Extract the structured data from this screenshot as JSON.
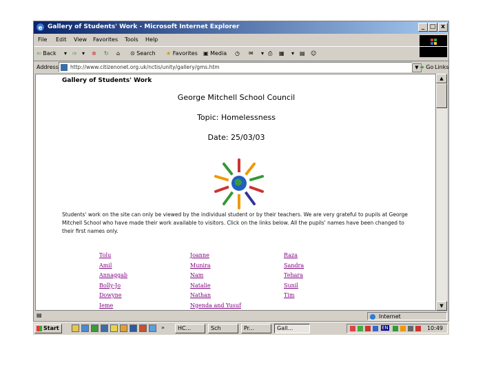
{
  "window": {
    "title": "Gallery of Students' Work - Microsoft Internet Explorer",
    "controls": [
      "_",
      "□",
      "x"
    ]
  },
  "menu": [
    "File",
    "Edit",
    "View",
    "Favorites",
    "Tools",
    "Help"
  ],
  "toolbar": {
    "back": "Back",
    "search": "Search",
    "favorites": "Favorites",
    "media": "Media"
  },
  "address": {
    "label": "Address",
    "url": "http://www.citizenonet.org.uk/nctis/unity/gallery/gms.htm",
    "go": "Go",
    "links": "Links"
  },
  "page": {
    "header": "Gallery of Students' Work",
    "school": "George Mitchell School Council",
    "topic": "Topic: Homelessness",
    "date": "Date: 25/03/03",
    "paragraph": "Students' work on the site can only be viewed by the individual student or by their teachers. We are very grateful to pupils at George Mitchell School who have made their work available to visitors. Click on the links below. All the pupils' names have been changed to their first names only.",
    "names_col1": [
      "Tolu",
      "Amil",
      "Annaggab",
      "Bolly-Jo",
      "Dowyne",
      "Ieme"
    ],
    "names_col2": [
      "Joanne",
      "Munira",
      "Nam",
      "Natalie",
      "Nathan",
      "Ngenda and Yusuf"
    ],
    "names_col3": [
      "Raza",
      "Sandra",
      "Tehara",
      "Sunil",
      "Tim"
    ]
  },
  "status": {
    "zone": "Internet"
  },
  "taskbar": {
    "start": "Start",
    "more": "»",
    "tasks": [
      "HC...",
      "Sch",
      "Pr...",
      "Gall..."
    ],
    "lang": "EN",
    "clock": "10:49"
  },
  "colors": {
    "titlebar_start": "#0a246a",
    "titlebar_end": "#a6caf0",
    "link_visited": "#800080",
    "chrome": "#d4d0c8"
  }
}
